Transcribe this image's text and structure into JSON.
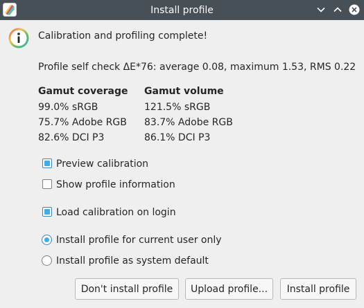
{
  "window": {
    "title": "Install profile"
  },
  "message": {
    "heading": "Calibration and profiling complete!",
    "self_check": "Profile self check ΔE*76: average 0.08, maximum 1.53, RMS 0.22"
  },
  "gamut": {
    "coverage_header": "Gamut coverage",
    "volume_header": "Gamut volume",
    "coverage": [
      "99.0% sRGB",
      "75.7% Adobe RGB",
      "82.6% DCI P3"
    ],
    "volume": [
      "121.5% sRGB",
      "83.7% Adobe RGB",
      "86.1% DCI P3"
    ]
  },
  "options": {
    "preview_calibration": {
      "label": "Preview calibration",
      "checked": true
    },
    "show_profile_info": {
      "label": "Show profile information",
      "checked": false
    },
    "load_on_login": {
      "label": "Load calibration on login",
      "checked": true
    }
  },
  "install_scope": {
    "current_user": {
      "label": "Install profile for current user only",
      "selected": true
    },
    "system_default": {
      "label": "Install profile as system default",
      "selected": false
    }
  },
  "buttons": {
    "dont_install": "Don't install profile",
    "upload": "Upload profile...",
    "install": "Install profile"
  },
  "icons": {
    "app": "displaycal-icon",
    "info": "info-icon",
    "minimize": "chevron-down-icon",
    "maximize": "chevron-up-icon",
    "close": "close-icon"
  },
  "colors": {
    "titlebar": "#475057",
    "accent": "#3daee9",
    "background": "#efefef"
  }
}
